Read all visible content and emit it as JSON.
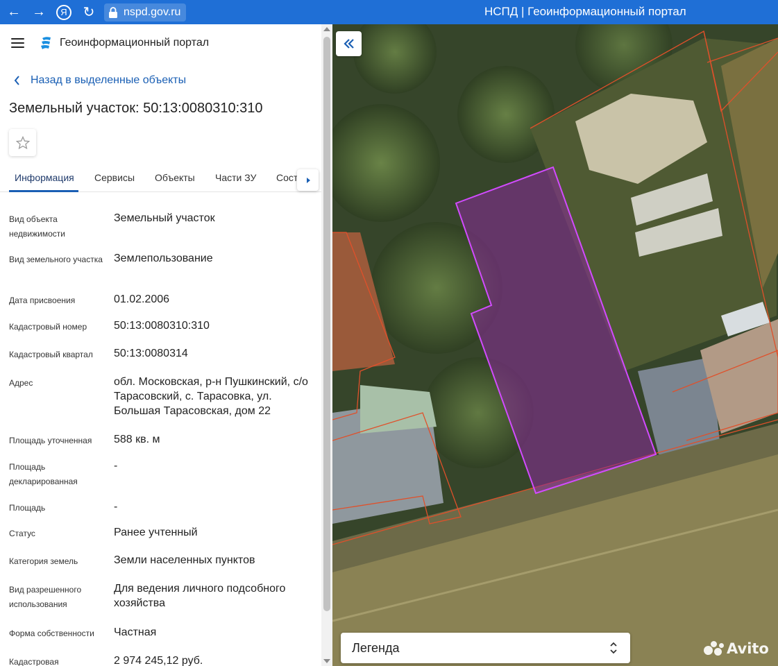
{
  "browser": {
    "url": "nspd.gov.ru",
    "window_title": "НСПД | Геоинформационный портал",
    "icons": [
      "back-arrow-icon",
      "forward-arrow-icon",
      "yandex-icon",
      "reload-icon",
      "lock-icon"
    ],
    "back_glyph": "←",
    "forward_glyph": "→",
    "yandex_glyph": "Я",
    "reload_glyph": "↻"
  },
  "header": {
    "app_title": "Геоинформационный портал"
  },
  "panel": {
    "back_link": "Назад в выделенные объекты",
    "object_title": "Земельный участок: 50:13:0080310:310",
    "tabs": [
      {
        "label": "Информация",
        "active": true
      },
      {
        "label": "Сервисы"
      },
      {
        "label": "Объекты"
      },
      {
        "label": "Части ЗУ"
      },
      {
        "label": "Сост"
      }
    ],
    "properties": [
      {
        "label": "Вид объекта недвижимости",
        "value": "Земельный участок"
      },
      {
        "label": "Вид земельного участка",
        "value": "Землепользование"
      },
      {
        "label": "Дата присвоения",
        "value": "01.02.2006"
      },
      {
        "label": "Кадастровый номер",
        "value": "50:13:0080310:310"
      },
      {
        "label": "Кадастровый квартал",
        "value": "50:13:0080314"
      },
      {
        "label": "Адрес",
        "value": "обл. Московская, р-н Пушкинский, с/о Тарасовский, с. Тарасовка, ул. Большая Тарасовская, дом 22"
      },
      {
        "label": "Площадь уточненная",
        "value": "588 кв. м"
      },
      {
        "label": "Площадь декларированная",
        "value": "-"
      },
      {
        "label": "Площадь",
        "value": "-"
      },
      {
        "label": "Статус",
        "value": "Ранее учтенный"
      },
      {
        "label": "Категория земель",
        "value": "Земли населенных пунктов"
      },
      {
        "label": "Вид разрешенного использования",
        "value": "Для ведения личного подсобного хозяйства"
      },
      {
        "label": "Форма собственности",
        "value": "Частная"
      },
      {
        "label": "Кадастровая",
        "value": "2 974 245,12 руб."
      }
    ]
  },
  "map": {
    "legend_label": "Легенда",
    "watermark": "Avito",
    "colors": {
      "selected_parcel_fill": "#8a2a9a",
      "selected_parcel_stroke": "#d24bff",
      "parcel_border": "#e0502a",
      "accent": "#1a5fb4"
    }
  }
}
